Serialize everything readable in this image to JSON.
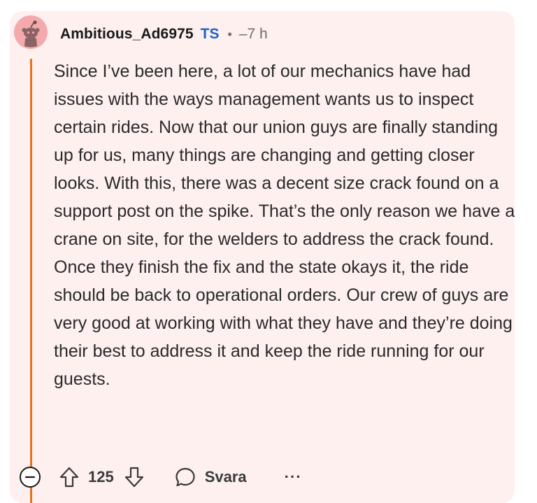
{
  "comment": {
    "author": "Ambitious_Ad6975",
    "badge": "TS",
    "separator": "•",
    "time": "–7 h",
    "body": "Since I’ve been here, a lot of our mechanics have had issues with the ways management wants us to inspect certain rides. Now that our union guys are finally standing up for us, many things are changing and getting closer looks. With this, there was a decent size crack found on a support post on the spike. That’s the only reason we have a crane on site, for the welders to address the crack found. Once they finish the fix and the state okays it, the ride should be back to operational orders. Our crew of guys are very good at working with what they have and they’re doing their best to address it and keep the ride running for our guests.",
    "votes": "125",
    "reply_label": "Svara",
    "more_label": "···"
  },
  "icons": {
    "avatar": "snoo-avatar-icon",
    "collapse": "collapse-minus-icon",
    "upvote": "upvote-arrow-icon",
    "downvote": "downvote-arrow-icon",
    "reply": "speech-bubble-icon",
    "more": "more-options-icon"
  },
  "colors": {
    "card_background": "#fdf0ee",
    "thread_line": "#e8731e",
    "badge": "#1e63c7",
    "avatar_bg": "#f4a9ad"
  }
}
